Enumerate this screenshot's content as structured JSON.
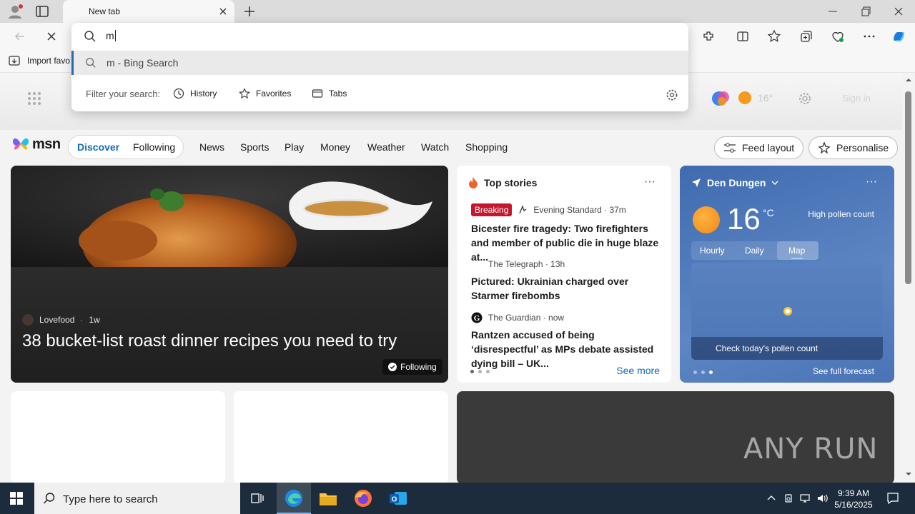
{
  "browser": {
    "tab_title": "New tab",
    "favorites_bar": {
      "import_label": "Import favo"
    }
  },
  "omnibox": {
    "query": "m",
    "suggestion": "m - Bing Search",
    "filter_label": "Filter your search:",
    "filters": [
      "History",
      "Favorites",
      "Tabs"
    ]
  },
  "header": {
    "temperature": "16°",
    "sign_in": "Sign in"
  },
  "msn": {
    "logo_text": "msn",
    "segments": [
      "Discover",
      "Following"
    ],
    "nav": [
      "News",
      "Sports",
      "Play",
      "Money",
      "Weather",
      "Watch",
      "Shopping"
    ],
    "feed_layout": "Feed layout",
    "personalise": "Personalise"
  },
  "hero": {
    "source": "Lovefood",
    "age": "1w",
    "title": "38 bucket-list roast dinner recipes you need to try",
    "following": "Following"
  },
  "top_stories": {
    "title": "Top stories",
    "items": [
      {
        "badge": "Breaking",
        "source": "Evening Standard · 37m",
        "title": "Bicester fire tragedy: Two firefighters and member of public die in huge blaze at..."
      },
      {
        "source": "The Telegraph · 13h",
        "title": "Pictured: Ukrainian charged over Starmer firebombs"
      },
      {
        "source": "The Guardian · now",
        "title": "Rantzen accused of being ‘disrespectful’ as MPs debate assisted dying bill – UK..."
      }
    ],
    "see_more": "See more"
  },
  "weather": {
    "location": "Den Dungen",
    "temperature": "16",
    "unit": "°C",
    "pollen": "High pollen count",
    "tabs": [
      "Hourly",
      "Daily",
      "Map"
    ],
    "selected_tab": "Map",
    "map_caption": "Check today's pollen count",
    "full_forecast": "See full forecast"
  },
  "watermark": "ANY RUN",
  "taskbar": {
    "search_placeholder": "Type here to search",
    "time": "9:39 AM",
    "date": "5/16/2025"
  },
  "colors": {
    "accent": "#0f6cbd",
    "breaking": "#c5162d",
    "weather_bg": "#4a73b6",
    "taskbar": "#1d2c3d"
  }
}
